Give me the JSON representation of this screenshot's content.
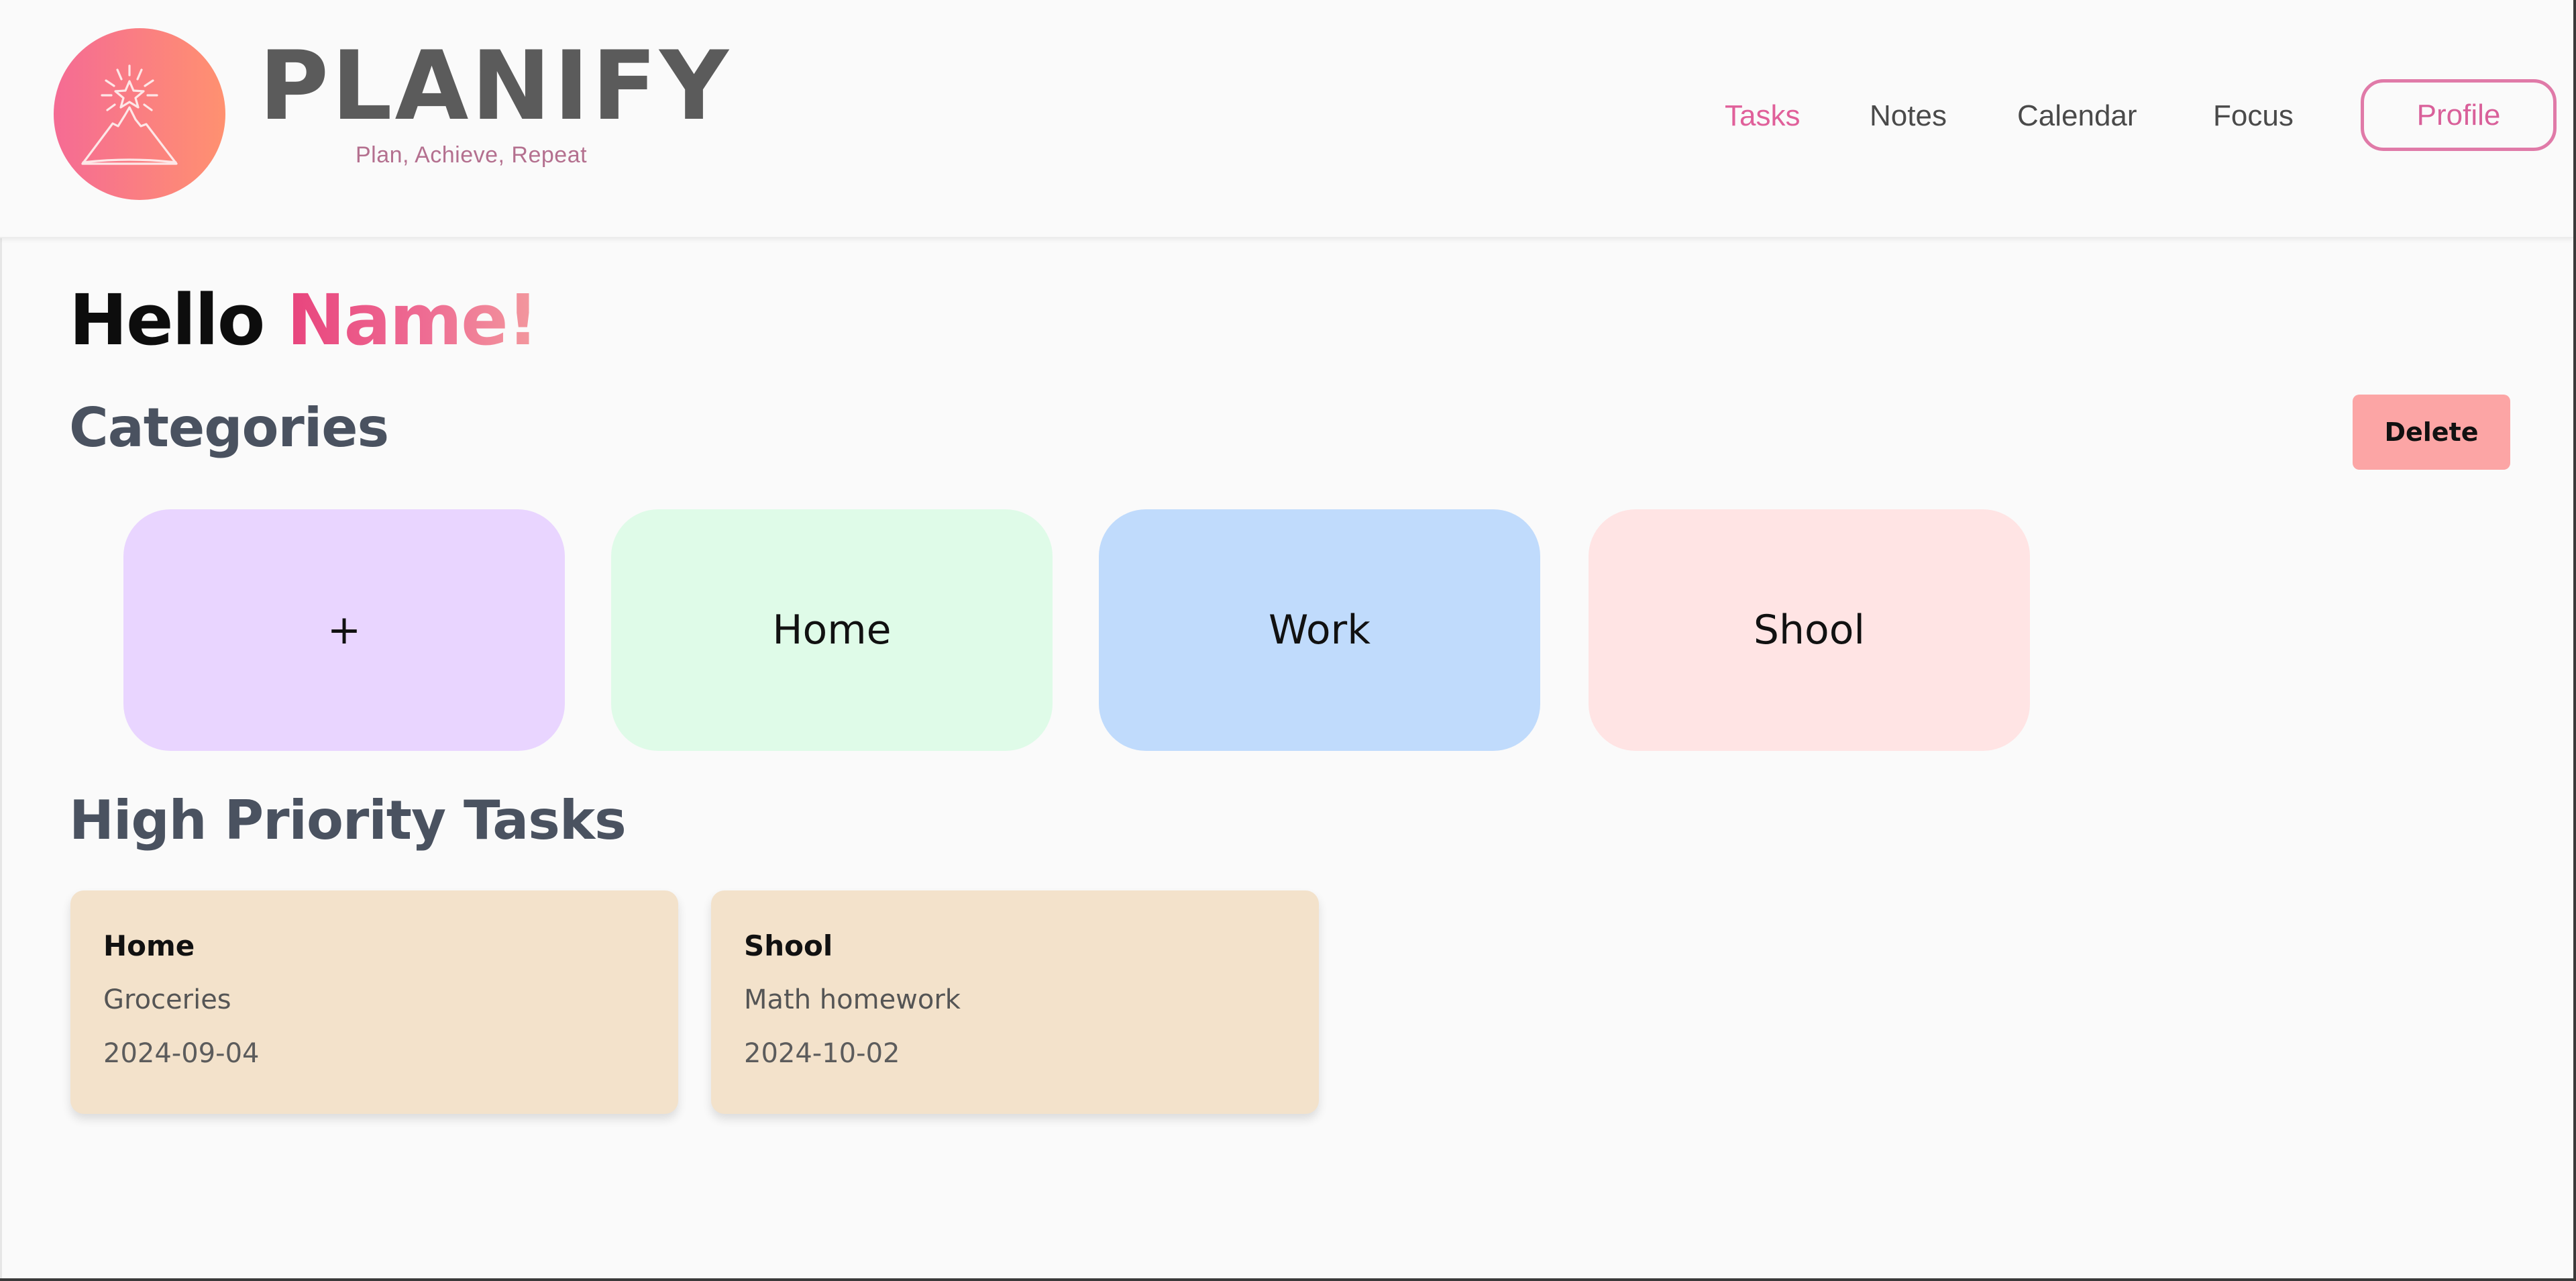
{
  "brand": {
    "name": "PLANIFY",
    "tagline": "Plan, Achieve, Repeat",
    "logo_icon": "mountain-star-icon",
    "gradient": [
      "#f56b94",
      "#ff9170"
    ]
  },
  "nav": {
    "items": [
      {
        "label": "Tasks",
        "active": true
      },
      {
        "label": "Notes",
        "active": false
      },
      {
        "label": "Calendar",
        "active": false
      },
      {
        "label": "Focus",
        "active": false
      }
    ],
    "profile_label": "Profile",
    "accent_color": "#e0609a"
  },
  "greeting": {
    "hello": "Hello",
    "name": "Name!"
  },
  "categories": {
    "title": "Categories",
    "delete_label": "Delete",
    "add_label": "+",
    "items": [
      {
        "label": "Home",
        "color": "#dffbe8"
      },
      {
        "label": "Work",
        "color": "#c0dbfc"
      },
      {
        "label": "Shool",
        "color": "#ffe4e4"
      }
    ],
    "add_color": "#e9d5ff"
  },
  "priority": {
    "title": "High Priority Tasks",
    "tasks": [
      {
        "category": "Home",
        "description": "Groceries",
        "date": "2024-09-04"
      },
      {
        "category": "Shool",
        "description": "Math homework",
        "date": "2024-10-02"
      }
    ]
  }
}
